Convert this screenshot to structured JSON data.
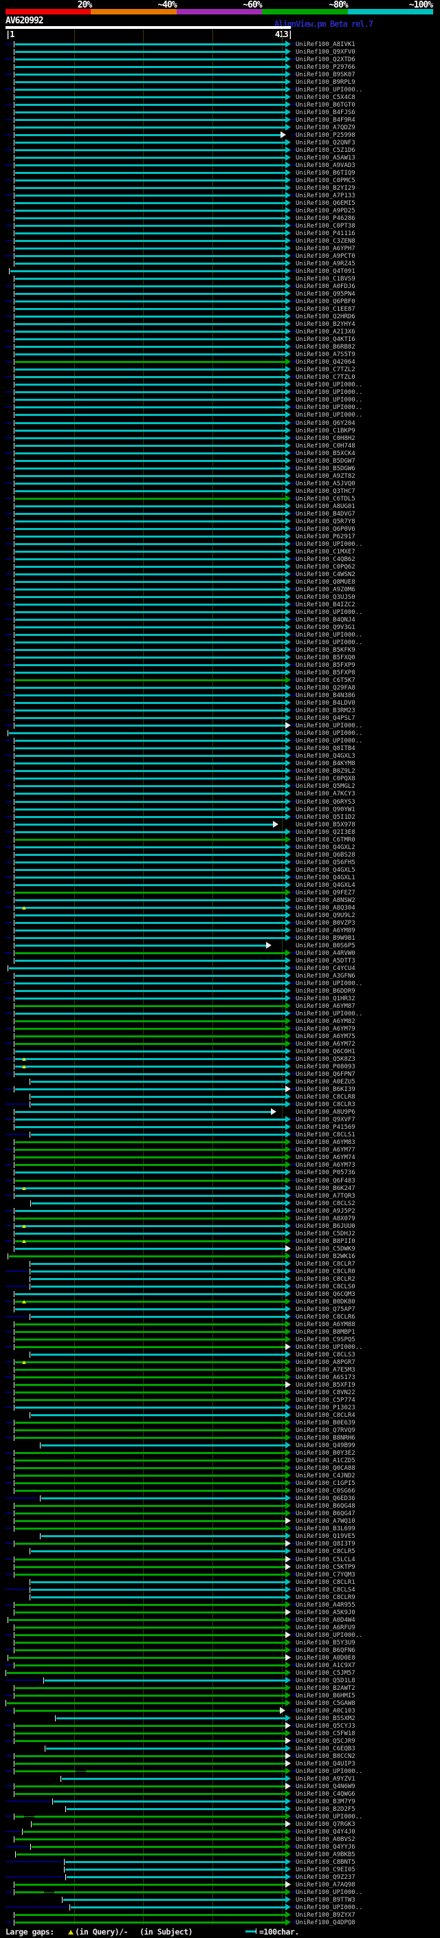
{
  "header": {
    "query_id": "AV620992",
    "app_title": "AlignView.pm Beta rel.7",
    "ruler_start": "1",
    "ruler_end": "413",
    "scale": [
      {
        "label": "20%",
        "color": "#f20000"
      },
      {
        "label": "~40%",
        "color": "#e57800"
      },
      {
        "label": "~60%",
        "color": "#a02cb4"
      },
      {
        "label": "~80%",
        "color": "#00a400"
      },
      {
        "label": "~100%",
        "color": "#00bfbf"
      }
    ]
  },
  "legend": {
    "gaps_prefix": "Large gaps: ",
    "gaps_query": "(in Query)/- ",
    "gaps_subject": "(in Subject)",
    "scale_note": "=100char."
  },
  "colors": {
    "cyan": "#00bfbf",
    "green": "#00a400",
    "navy": "#000078",
    "grid": "#3a3a06",
    "open_arrow": "#e8e8e8",
    "label": "#c8c8c8"
  },
  "chart_data": {
    "type": "alignment-hit-map",
    "title": "AlignView.pm Beta rel.7",
    "query_id": "AV620992",
    "query_length": 413,
    "ruler_ticks_every_chars": 100,
    "identity_bins": [
      {
        "label": "20%",
        "color": "#f20000"
      },
      {
        "label": "~40%",
        "color": "#e57800"
      },
      {
        "label": "~60%",
        "color": "#a02cb4"
      },
      {
        "label": "~80%",
        "color": "#00a400"
      },
      {
        "label": "~100%",
        "color": "#00bfbf"
      }
    ],
    "label_prefix": "UniRef100_",
    "row_format": "[id_suffix, colorbin c=~100% g=~80%, qstart=15, qend=413, arrow s=solid|o=open, gap_in_query_at, gap_in_subject_from, gap_in_subject_to]",
    "rows": [
      [
        "A8IVK1",
        "c"
      ],
      [
        "Q9XFV0",
        "c"
      ],
      [
        "Q2XTD6",
        "c"
      ],
      [
        "P29766",
        "c"
      ],
      [
        "B9SK07",
        "c"
      ],
      [
        "B9RPL9",
        "c"
      ],
      [
        "UPI000..",
        "c"
      ],
      [
        "C5X4C8",
        "c"
      ],
      [
        "B6TGT0",
        "c"
      ],
      [
        "B4FJS6",
        "c"
      ],
      [
        "B4F9R4",
        "c"
      ],
      [
        "A7QDZ9",
        "c"
      ],
      [
        "P25998",
        "c",
        15,
        406,
        "o"
      ],
      [
        "Q2QNF3",
        "c"
      ],
      [
        "C5Z1D6",
        "c"
      ],
      [
        "A5AW13",
        "c"
      ],
      [
        "A9VAD3",
        "c"
      ],
      [
        "B6TIQ9",
        "c"
      ],
      [
        "C0PMC5",
        "c"
      ],
      [
        "B2YI29",
        "c"
      ],
      [
        "A7P133",
        "c"
      ],
      [
        "Q6EMI5",
        "c"
      ],
      [
        "A9PD25",
        "c"
      ],
      [
        "P46286",
        "c"
      ],
      [
        "C0PT38",
        "c"
      ],
      [
        "P41116",
        "c"
      ],
      [
        "C3ZEN8",
        "c"
      ],
      [
        "A6YPH7",
        "c"
      ],
      [
        "A9PCT0",
        "c"
      ],
      [
        "A9RZ45",
        "c"
      ],
      [
        "Q4T091",
        "c",
        8
      ],
      [
        "C1BVS9",
        "c"
      ],
      [
        "A0FDJ6",
        "c"
      ],
      [
        "Q95PN4",
        "c"
      ],
      [
        "Q6PBF0",
        "c"
      ],
      [
        "C1EE87",
        "c"
      ],
      [
        "Q2HRD6",
        "c"
      ],
      [
        "B2YHY4",
        "c"
      ],
      [
        "A2I3X6",
        "c"
      ],
      [
        "Q4KTI6",
        "c"
      ],
      [
        "B6RB82",
        "c"
      ],
      [
        "A7S5T9",
        "c"
      ],
      [
        "Q42064",
        "g"
      ],
      [
        "C7TZL2",
        "c"
      ],
      [
        "C7TZL0",
        "c"
      ],
      [
        "UPI000..",
        "c"
      ],
      [
        "UPI000..",
        "c"
      ],
      [
        "UPI000..",
        "c"
      ],
      [
        "UPI000..",
        "c"
      ],
      [
        "UPI000..",
        "c"
      ],
      [
        "Q6Y204",
        "c"
      ],
      [
        "C1BKP9",
        "c"
      ],
      [
        "C0H8H2",
        "c"
      ],
      [
        "C0H748",
        "c"
      ],
      [
        "B5XCK4",
        "c"
      ],
      [
        "B5DGW7",
        "c"
      ],
      [
        "B5DGW6",
        "c"
      ],
      [
        "A9ZT82",
        "c"
      ],
      [
        "A5JVQ0",
        "c"
      ],
      [
        "Q3THC7",
        "c"
      ],
      [
        "C6TDL5",
        "g"
      ],
      [
        "A8UG01",
        "c"
      ],
      [
        "B4DVG7",
        "c"
      ],
      [
        "Q5R7Y8",
        "c"
      ],
      [
        "Q6P0V6",
        "c"
      ],
      [
        "P62917",
        "c"
      ],
      [
        "UPI000..",
        "c"
      ],
      [
        "C1MXE7",
        "c"
      ],
      [
        "C4QB62",
        "c"
      ],
      [
        "C0PQ62",
        "c"
      ],
      [
        "C4WSN2",
        "c"
      ],
      [
        "Q8MUE8",
        "c"
      ],
      [
        "A9Z0M6",
        "c"
      ],
      [
        "Q3UJS0",
        "c"
      ],
      [
        "B4IZC2",
        "c"
      ],
      [
        "UPI000..",
        "c"
      ],
      [
        "B4QNJ4",
        "c"
      ],
      [
        "Q9V3G1",
        "c"
      ],
      [
        "UPI000..",
        "c"
      ],
      [
        "UPI000..",
        "c"
      ],
      [
        "B5KFK9",
        "c"
      ],
      [
        "B5FXQ0",
        "c"
      ],
      [
        "B5FXP9",
        "c"
      ],
      [
        "B5FXP8",
        "c"
      ],
      [
        "C6T5K7",
        "g"
      ],
      [
        "Q29FA8",
        "c"
      ],
      [
        "B4N386",
        "c"
      ],
      [
        "B4LDV0",
        "c"
      ],
      [
        "B3RM23",
        "c"
      ],
      [
        "Q4PSL7",
        "c"
      ],
      [
        "UPI000..",
        "c",
        15,
        413,
        "o"
      ],
      [
        "UPI000..",
        "c",
        6
      ],
      [
        "UPI000..",
        "c"
      ],
      [
        "Q8ITB4",
        "c"
      ],
      [
        "Q4GXL3",
        "c"
      ],
      [
        "B4KYM8",
        "c"
      ],
      [
        "B0Z9L2",
        "c"
      ],
      [
        "C0PQX8",
        "c"
      ],
      [
        "Q5MGL2",
        "c"
      ],
      [
        "A7KCY3",
        "c"
      ],
      [
        "Q6RYS3",
        "c"
      ],
      [
        "Q90YW1",
        "c"
      ],
      [
        "Q5I1D2",
        "c"
      ],
      [
        "B5X978",
        "c",
        15,
        395,
        "o"
      ],
      [
        "Q2I3E8",
        "c"
      ],
      [
        "C6TMR0",
        "g"
      ],
      [
        "Q4GXL2",
        "c"
      ],
      [
        "Q6BS28",
        "c"
      ],
      [
        "Q56FH5",
        "c"
      ],
      [
        "Q4GXL5",
        "c"
      ],
      [
        "Q4GXL1",
        "c"
      ],
      [
        "Q4GXL4",
        "c"
      ],
      [
        "Q9FEZ7",
        "g"
      ],
      [
        "A8NSW2",
        "c"
      ],
      [
        "A8Q304",
        "c",
        15,
        413,
        "s",
        28
      ],
      [
        "Q9U9L2",
        "c"
      ],
      [
        "B0VZP3",
        "c"
      ],
      [
        "A6YM89",
        "c"
      ],
      [
        "B9W9B1",
        "c"
      ],
      [
        "B0S6P5",
        "c",
        15,
        385,
        "o"
      ],
      [
        "A4RVW0",
        "g"
      ],
      [
        "A5DTT3",
        "c"
      ],
      [
        "C4YCU4",
        "c",
        6
      ],
      [
        "A3GFN6",
        "c"
      ],
      [
        "UPI000..",
        "c"
      ],
      [
        "B6DDR9",
        "c"
      ],
      [
        "Q1HR32",
        "c"
      ],
      [
        "A6YM87",
        "g"
      ],
      [
        "UPI000..",
        "c"
      ],
      [
        "A6YM82",
        "g"
      ],
      [
        "A6YM79",
        "g"
      ],
      [
        "A6YM75",
        "g"
      ],
      [
        "A6YM72",
        "g"
      ],
      [
        "Q6C0H1",
        "c"
      ],
      [
        "Q5K8Z3",
        "c",
        15,
        413,
        "s",
        28
      ],
      [
        "P08093",
        "c",
        15,
        413,
        "s",
        28
      ],
      [
        "Q6FPN7",
        "c"
      ],
      [
        "A0EZU5",
        "c",
        38
      ],
      [
        "B6KI39",
        "c",
        15,
        413,
        "o"
      ],
      [
        "C8CLR8",
        "c",
        38
      ],
      [
        "C8CLR3",
        "c",
        38
      ],
      [
        "A8U9P6",
        "c",
        15,
        392,
        "o"
      ],
      [
        "Q9XVF7",
        "c"
      ],
      [
        "P41569",
        "c"
      ],
      [
        "C8CLS1",
        "c",
        38
      ],
      [
        "A6YM83",
        "g"
      ],
      [
        "A6YM77",
        "g"
      ],
      [
        "A6YM74",
        "g"
      ],
      [
        "A6YM73",
        "g"
      ],
      [
        "P05736",
        "c"
      ],
      [
        "Q6F483",
        "g"
      ],
      [
        "B6K247",
        "c",
        15,
        413,
        "s",
        28
      ],
      [
        "A7TQR3",
        "c"
      ],
      [
        "C8CLS2",
        "c",
        39
      ],
      [
        "A9J5P2",
        "c"
      ],
      [
        "A8X079",
        "g"
      ],
      [
        "B6JUU0",
        "c",
        15,
        413,
        "s",
        28
      ],
      [
        "C5DHJ2",
        "c"
      ],
      [
        "B8PII0",
        "g",
        15,
        413,
        "s",
        28
      ],
      [
        "C5DWK9",
        "c",
        15,
        413,
        "o"
      ],
      [
        "B2WK16",
        "g",
        6
      ],
      [
        "C8CLR7",
        "c",
        38
      ],
      [
        "C8CLR0",
        "c",
        38
      ],
      [
        "C8CLR2",
        "c",
        38
      ],
      [
        "C8CLS0",
        "c",
        38
      ],
      [
        "Q6CQM3",
        "c"
      ],
      [
        "B0DK80",
        "g",
        15,
        413,
        "s",
        28
      ],
      [
        "Q75AP7",
        "c"
      ],
      [
        "C8CLR6",
        "c",
        38
      ],
      [
        "A6YM88",
        "g"
      ],
      [
        "B8MBP1",
        "g"
      ],
      [
        "C9SPQ5",
        "g"
      ],
      [
        "UPI000..",
        "g",
        15,
        413,
        "o"
      ],
      [
        "C8CLS3",
        "c",
        38
      ],
      [
        "A8PGR7",
        "g",
        15,
        413,
        "s",
        28
      ],
      [
        "A7E5M3",
        "g"
      ],
      [
        "A6S173",
        "g"
      ],
      [
        "B5XFI9",
        "g",
        15,
        413,
        "o"
      ],
      [
        "C8VN22",
        "g"
      ],
      [
        "C5P774",
        "g"
      ],
      [
        "P13023",
        "c"
      ],
      [
        "C8CLR4",
        "c",
        38
      ],
      [
        "B0E639",
        "g"
      ],
      [
        "Q7RVQ9",
        "g"
      ],
      [
        "B8NRH6",
        "g"
      ],
      [
        "Q49B99",
        "c",
        53
      ],
      [
        "B0Y3E2",
        "g"
      ],
      [
        "A1CZD5",
        "g"
      ],
      [
        "Q0CA88",
        "g"
      ],
      [
        "C4JND2",
        "g"
      ],
      [
        "C1GPI5",
        "g"
      ],
      [
        "C0SG66",
        "g"
      ],
      [
        "Q6ED36",
        "c",
        53
      ],
      [
        "B6QG48",
        "g"
      ],
      [
        "B6QG47",
        "g"
      ],
      [
        "A7WQ10",
        "g",
        15,
        413,
        "o"
      ],
      [
        "B3L699",
        "g"
      ],
      [
        "Q19VE5",
        "c",
        53
      ],
      [
        "Q8I3T9",
        "g",
        15,
        413,
        "o"
      ],
      [
        "C8CLR5",
        "c",
        38
      ],
      [
        "C5LCL4",
        "g",
        15,
        413,
        "o"
      ],
      [
        "C5KTP9",
        "g",
        15,
        413,
        "o"
      ],
      [
        "C7YQM3",
        "g"
      ],
      [
        "C8CLR1",
        "c",
        38
      ],
      [
        "C8CLS4",
        "c",
        38
      ],
      [
        "C8CLR9",
        "c",
        38
      ],
      [
        "A4R955",
        "g"
      ],
      [
        "A5K9J0",
        "g",
        15,
        413,
        "o"
      ],
      [
        "A0D4W4",
        "g",
        6
      ],
      [
        "A6RFU9",
        "g"
      ],
      [
        "UPI000..",
        "g",
        15,
        413,
        "o"
      ],
      [
        "B5Y3U9",
        "g"
      ],
      [
        "B6QFN6",
        "g"
      ],
      [
        "A0D0E8",
        "g",
        6,
        413,
        "o"
      ],
      [
        "A1C9X7",
        "g"
      ],
      [
        "C5JM57",
        "g",
        3
      ],
      [
        "Q5D1L8",
        "c",
        58
      ],
      [
        "B2AWT2",
        "g"
      ],
      [
        "B6HMI5",
        "g"
      ],
      [
        "C5GAW8",
        "g",
        3
      ],
      [
        "A0C103",
        "g",
        15,
        405,
        "o"
      ],
      [
        "B5SXM2",
        "c",
        74
      ],
      [
        "Q5CYJ3",
        "g",
        15,
        413,
        "o"
      ],
      [
        "C5FW18",
        "g"
      ],
      [
        "Q5CJR9",
        "g",
        15,
        413,
        "o"
      ],
      [
        "C6EQB3",
        "c",
        60
      ],
      [
        "B8CCN2",
        "g",
        15,
        413,
        "o"
      ],
      [
        "Q4UIP3",
        "g",
        15,
        413,
        "o"
      ],
      [
        "UPI000..",
        "g",
        15,
        413,
        "s",
        0,
        102,
        117
      ],
      [
        "A9YZV1",
        "c",
        82
      ],
      [
        "Q4N6W9",
        "g",
        15,
        413,
        "o"
      ],
      [
        "C4QWG6",
        "g"
      ],
      [
        "B3M7Y9",
        "c",
        70
      ],
      [
        "B2D2F5",
        "c",
        89
      ],
      [
        "UPI000..",
        "g",
        15,
        413,
        "s",
        0,
        28,
        43
      ],
      [
        "Q7RGK3",
        "g",
        40,
        413,
        "o"
      ],
      [
        "Q4Y4J0",
        "g",
        27
      ],
      [
        "A0BVS2",
        "g"
      ],
      [
        "Q4YYJ6",
        "g",
        39
      ],
      [
        "A9BKB5",
        "g",
        17
      ],
      [
        "C8BNT5",
        "c",
        87
      ],
      [
        "C9EI05",
        "c",
        87
      ],
      [
        "Q9Z237",
        "c",
        89
      ],
      [
        "A7AQ98",
        "g",
        15,
        413,
        "o"
      ],
      [
        "UPI000..",
        "g",
        15,
        413,
        "s",
        0,
        57,
        71
      ],
      [
        "B9TTW3",
        "c",
        84
      ],
      [
        "UPI000..",
        "c",
        95
      ],
      [
        "B9ZYX7",
        "g"
      ],
      [
        "Q4DPQ8",
        "g"
      ]
    ]
  }
}
